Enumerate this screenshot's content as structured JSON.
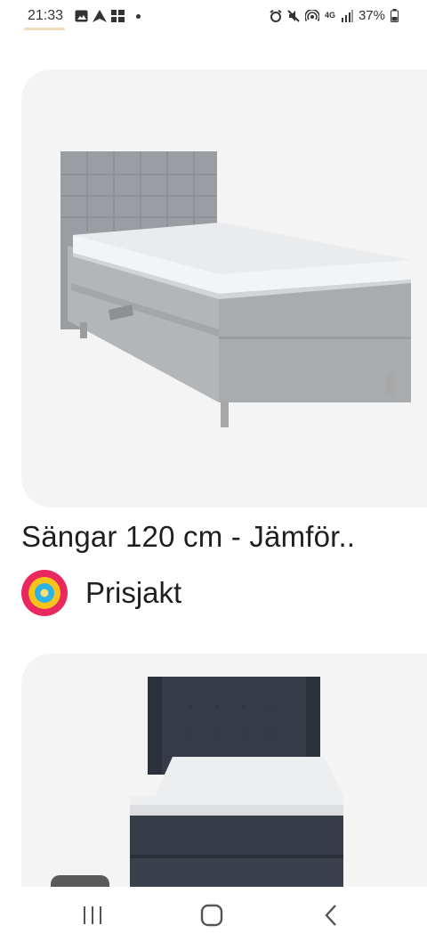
{
  "status_bar": {
    "time": "21:33",
    "left_icons": [
      "gallery-icon",
      "navigation-icon",
      "app-grid-icon",
      "dot-icon"
    ],
    "right_icons": [
      "alarm-icon",
      "mute-icon",
      "hotspot-icon",
      "4g-icon",
      "signal-icon"
    ],
    "network": "4G",
    "battery": "37%"
  },
  "results": [
    {
      "title": "Sängar 120 cm - Jämför..",
      "source": "Prisjakt",
      "source_icon": "prisjakt-logo-icon",
      "image": "grey-continental-bed-image"
    },
    {
      "image": "dark-blue-continental-bed-image"
    }
  ],
  "nav_bar": {
    "recent": "recent-apps-icon",
    "home": "home-icon",
    "back": "back-icon"
  },
  "colors": {
    "card_bg": "#f4f4f4",
    "bed1_fabric": "#a9adb0",
    "bed2_fabric": "#3b4250",
    "prisjakt_outer": "#e8285e",
    "prisjakt_mid": "#f7c21a",
    "prisjakt_inner": "#2bb3e6"
  }
}
